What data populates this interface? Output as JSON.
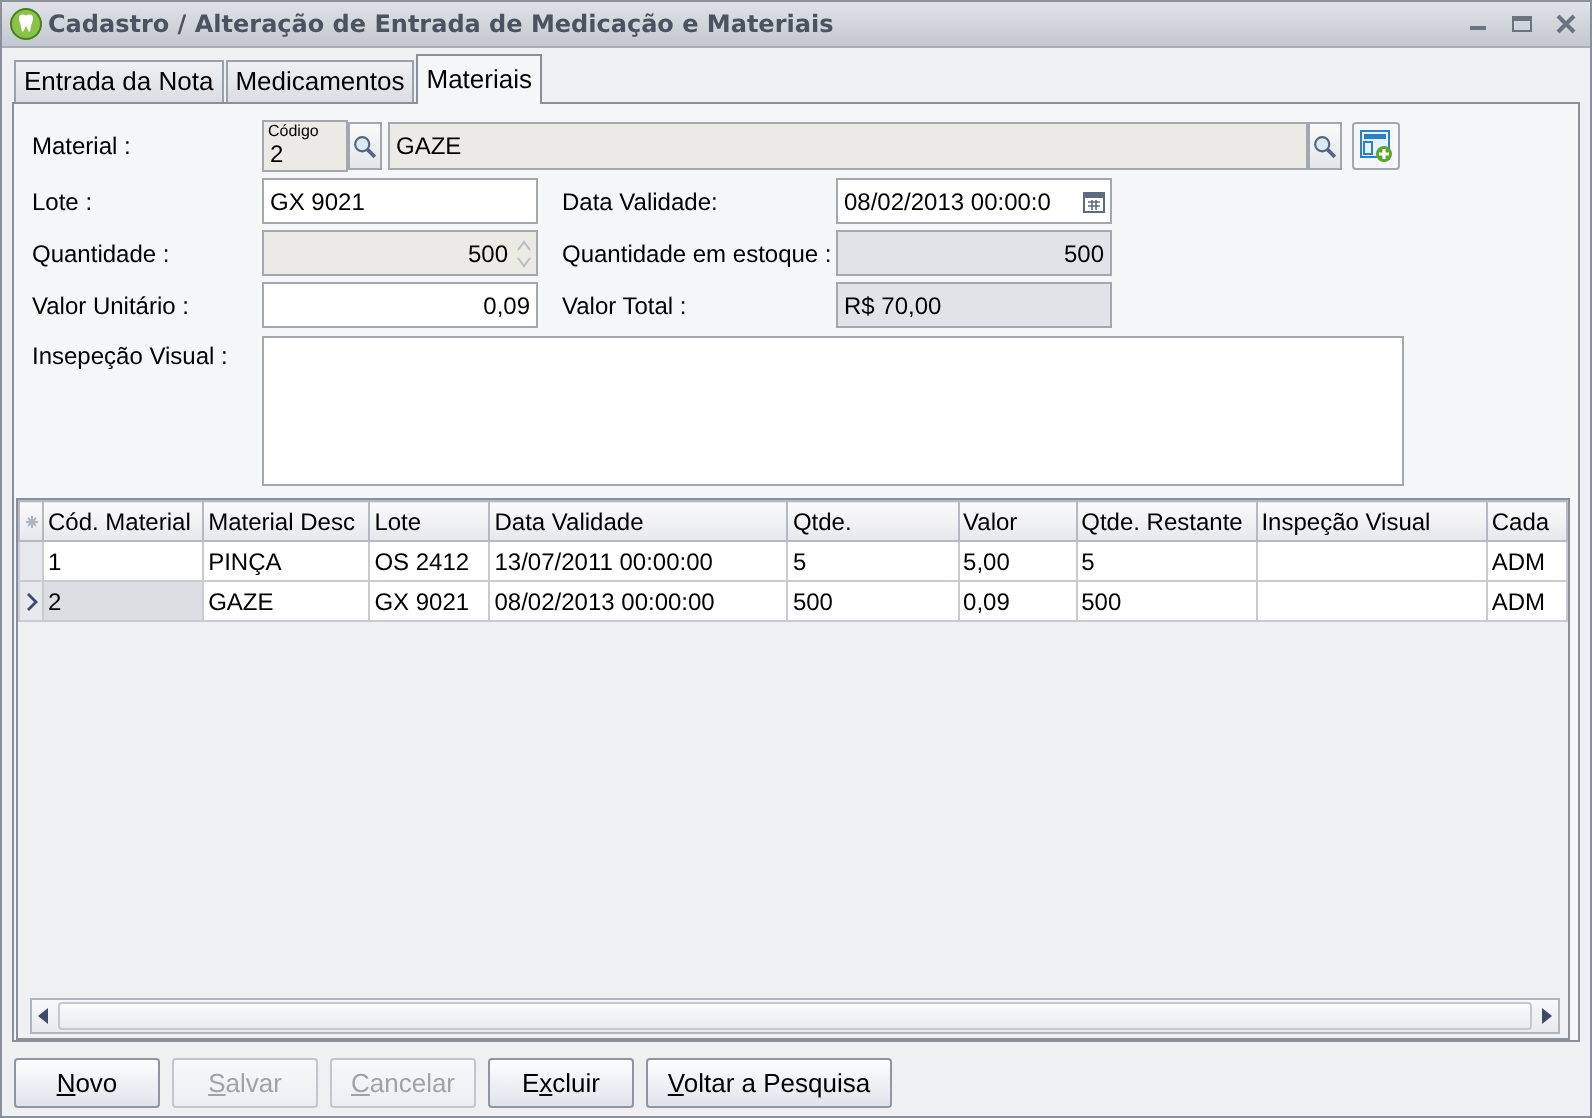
{
  "window": {
    "title": "Cadastro / Alteração de Entrada de Medicação e Materiais"
  },
  "tabs": [
    {
      "label": "Entrada da Nota",
      "selected": false
    },
    {
      "label": "Medicamentos",
      "selected": false
    },
    {
      "label": "Materiais",
      "selected": true
    }
  ],
  "form": {
    "material": {
      "label": "Material :",
      "code_caption": "Código",
      "code": "2",
      "description": "GAZE"
    },
    "lote": {
      "label": "Lote :",
      "value": "GX 9021"
    },
    "data_validade": {
      "label": "Data Validade:",
      "value": "08/02/2013 00:00:0"
    },
    "quantidade": {
      "label": "Quantidade :",
      "value": "500"
    },
    "quantidade_estoque": {
      "label": "Quantidade em estoque :",
      "value": "500"
    },
    "valor_unitario": {
      "label": "Valor Unitário :",
      "value": "0,09"
    },
    "valor_total": {
      "label": "Valor Total :",
      "value": "R$ 70,00"
    },
    "inspecao_visual": {
      "label": "Insepeção Visual :"
    }
  },
  "table": {
    "columns": [
      "Cód. Material",
      "Material Desc",
      "Lote",
      "Data Validade",
      "Qtde.",
      "Valor",
      "Qtde. Restante",
      "Inspeção Visual",
      "Cada"
    ],
    "rows": [
      {
        "selected": false,
        "cells": [
          "1",
          "PINÇA",
          "OS 2412",
          "13/07/2011 00:00:00",
          "5",
          "5,00",
          "5",
          "",
          "ADM"
        ]
      },
      {
        "selected": true,
        "cells": [
          "2",
          "GAZE",
          "GX 9021",
          "08/02/2013 00:00:00",
          "500",
          "0,09",
          "500",
          "",
          "ADM"
        ]
      }
    ]
  },
  "buttons": [
    {
      "key": "N",
      "post": "ovo",
      "disabled": false
    },
    {
      "key": "S",
      "post": "alvar",
      "disabled": true
    },
    {
      "key": "C",
      "post": "ancelar",
      "disabled": true
    },
    {
      "pre": "E",
      "key": "x",
      "post": "cluir",
      "disabled": false
    },
    {
      "key": "V",
      "post": "oltar a Pesquisa",
      "disabled": false
    }
  ]
}
